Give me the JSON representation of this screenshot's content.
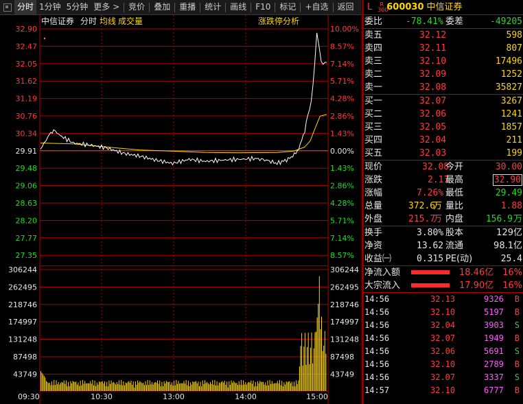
{
  "toolbar": {
    "items": [
      "分时",
      "1分钟",
      "5分钟",
      "更多 >",
      "竞价",
      "叠加",
      "重播",
      "统计",
      "画线",
      "F10",
      "标记",
      "+自选",
      "返回"
    ]
  },
  "chart_header": {
    "stock_name": "中信证券",
    "mode": "分时",
    "avg_label": "均线",
    "vol_label": "成交量",
    "analysis_label": "涨跌停分析"
  },
  "colors": {
    "up": "#ff3c3c",
    "down": "#22dd22",
    "avg": "#ffd700",
    "grid": "#b00000",
    "price_line": "#ffffff"
  },
  "chart_data": {
    "type": "line",
    "price_axis_left": [
      "32.90",
      "32.47",
      "32.05",
      "31.62",
      "31.19",
      "30.76",
      "30.34",
      "29.91",
      "29.48",
      "29.06",
      "28.63",
      "28.20",
      "27.77",
      "27.35"
    ],
    "percent_axis_right": [
      "10.00%",
      "8.57%",
      "7.14%",
      "5.71%",
      "4.28%",
      "2.86%",
      "1.43%",
      "0.00%",
      "1.43%",
      "2.86%",
      "4.28%",
      "5.71%",
      "7.14%",
      "8.57%"
    ],
    "volume_axis": [
      "306244",
      "262495",
      "218746",
      "174997",
      "131248",
      "87498",
      "43749"
    ],
    "time_labels": [
      "09:30",
      "10:30",
      "13:00",
      "14:00",
      "15:00"
    ],
    "prev_close": 29.91,
    "price_range": [
      26.92,
      32.9
    ],
    "volume_max": 350000,
    "price_series": [
      [
        0,
        29.95
      ],
      [
        8,
        30.3
      ],
      [
        12,
        30.42
      ],
      [
        18,
        30.28
      ],
      [
        30,
        30.1
      ],
      [
        45,
        30.05
      ],
      [
        60,
        29.98
      ],
      [
        75,
        29.85
      ],
      [
        90,
        29.78
      ],
      [
        105,
        29.68
      ],
      [
        120,
        29.6
      ],
      [
        135,
        29.7
      ],
      [
        150,
        29.65
      ],
      [
        165,
        29.68
      ],
      [
        180,
        29.7
      ],
      [
        195,
        29.72
      ],
      [
        205,
        29.68
      ],
      [
        215,
        29.6
      ],
      [
        225,
        29.7
      ],
      [
        232,
        29.85
      ],
      [
        236,
        30.05
      ],
      [
        240,
        30.4
      ],
      [
        243,
        30.8
      ],
      [
        246,
        31.1
      ],
      [
        249,
        32.0
      ],
      [
        251,
        32.85
      ],
      [
        253,
        32.5
      ],
      [
        255,
        32.05
      ],
      [
        260,
        32.08
      ]
    ],
    "avg_series": [
      [
        0,
        30.1
      ],
      [
        30,
        30.08
      ],
      [
        60,
        30.0
      ],
      [
        90,
        29.93
      ],
      [
        120,
        29.9
      ],
      [
        150,
        29.87
      ],
      [
        180,
        29.86
      ],
      [
        215,
        29.87
      ],
      [
        230,
        29.9
      ],
      [
        240,
        30.0
      ],
      [
        245,
        30.15
      ],
      [
        250,
        30.5
      ],
      [
        254,
        30.76
      ],
      [
        260,
        30.8
      ]
    ]
  },
  "stock": {
    "code_prefix": "L",
    "market": "R\n300",
    "code": "600030",
    "name": "中信证券"
  },
  "ratio": {
    "wb_label": "委比",
    "wb_value": "-78.41%",
    "wc_label": "委差",
    "wc_value": "-49205"
  },
  "asks": [
    {
      "label": "卖五",
      "price": "32.12",
      "vol": "598"
    },
    {
      "label": "卖四",
      "price": "32.11",
      "vol": "807"
    },
    {
      "label": "卖三",
      "price": "32.10",
      "vol": "17496"
    },
    {
      "label": "卖二",
      "price": "32.09",
      "vol": "1252"
    },
    {
      "label": "卖一",
      "price": "32.08",
      "vol": "35827"
    }
  ],
  "bids": [
    {
      "label": "买一",
      "price": "32.07",
      "vol": "3267"
    },
    {
      "label": "买二",
      "price": "32.06",
      "vol": "1241"
    },
    {
      "label": "买三",
      "price": "32.05",
      "vol": "1857"
    },
    {
      "label": "买四",
      "price": "32.04",
      "vol": "211"
    },
    {
      "label": "买五",
      "price": "32.03",
      "vol": "199"
    }
  ],
  "quote": {
    "xj_l": "现价",
    "xj_v": "32.08",
    "jk_l": "今开",
    "jk_v": "30.00",
    "zd_l": "涨跌",
    "zd_v": "2.17",
    "zg_l": "最高",
    "zg_v": "32.90",
    "zf_l": "涨幅",
    "zf_v": "7.26%",
    "zdi_l": "最低",
    "zdi_v": "29.49",
    "zl_l": "总量",
    "zl_v": "372.6",
    "zl_u": "万",
    "lb_l": "量比",
    "lb_v": "1.88",
    "wp_l": "外盘",
    "wp_v": "215.7",
    "wp_u": "万",
    "np_l": "内盘",
    "np_v": "156.9",
    "np_u": "万"
  },
  "fundamentals": {
    "hs_l": "换手",
    "hs_v": "3.80%",
    "gb_l": "股本",
    "gb_v": "129亿",
    "jz_l": "净资",
    "jz_v": "13.62",
    "lt_l": "流通",
    "lt_v": "98.1亿",
    "sy_l": "收益㈠",
    "sy_v": "0.315",
    "pe_l": "PE(动)",
    "pe_v": "25.4"
  },
  "flows": [
    {
      "label": "净流入额",
      "value": "18.46亿",
      "pct": "16%"
    },
    {
      "label": "大宗流入",
      "value": "17.90亿",
      "pct": "16%"
    }
  ],
  "ticks": [
    {
      "time": "14:56",
      "price": "32.13",
      "vol": "9326",
      "side": "B"
    },
    {
      "time": "14:56",
      "price": "32.10",
      "vol": "5197",
      "side": "B"
    },
    {
      "time": "14:56",
      "price": "32.04",
      "vol": "3903",
      "side": "S"
    },
    {
      "time": "14:56",
      "price": "32.07",
      "vol": "1949",
      "side": "B"
    },
    {
      "time": "14:56",
      "price": "32.06",
      "vol": "5691",
      "side": "S"
    },
    {
      "time": "14:56",
      "price": "32.10",
      "vol": "2789",
      "side": "B"
    },
    {
      "time": "14:56",
      "price": "32.07",
      "vol": "3337",
      "side": "S"
    },
    {
      "time": "14:57",
      "price": "32.10",
      "vol": "6777",
      "side": "B"
    }
  ]
}
